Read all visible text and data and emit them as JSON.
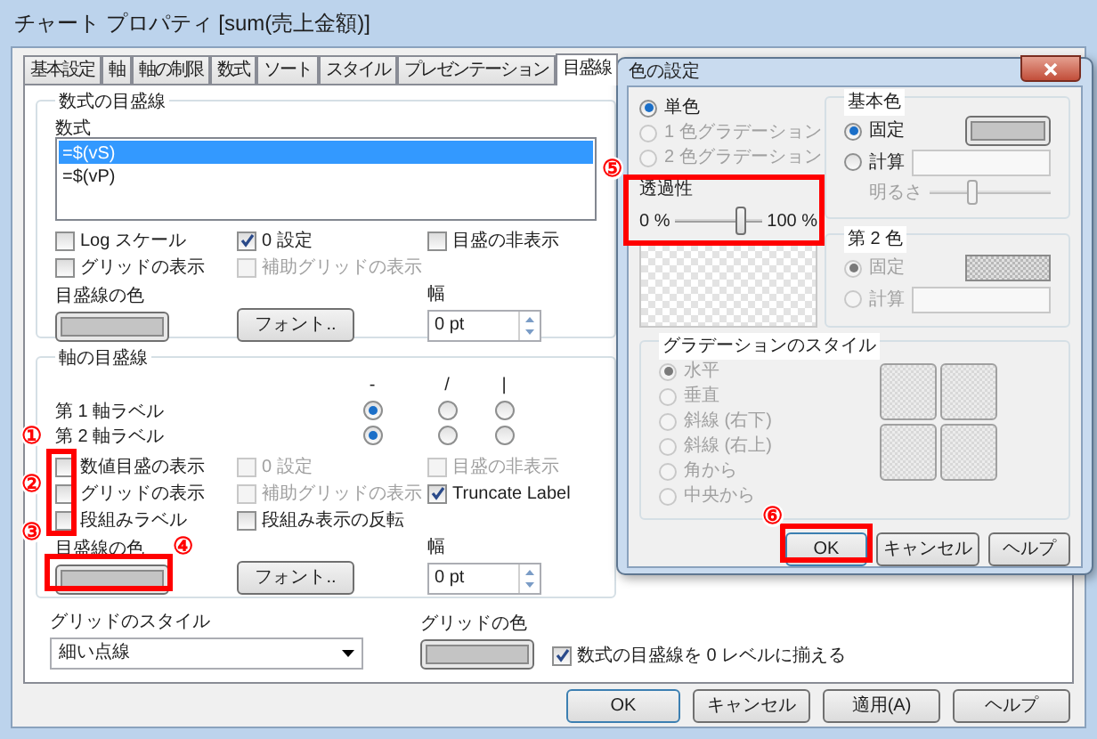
{
  "window": {
    "title": "チャート プロパティ [sum(売上金額)]"
  },
  "tabs": [
    {
      "label": "基本設定",
      "selected": false
    },
    {
      "label": "軸",
      "selected": false
    },
    {
      "label": "軸の制限",
      "selected": false
    },
    {
      "label": "数式",
      "selected": false
    },
    {
      "label": "ソート",
      "selected": false
    },
    {
      "label": "スタイル",
      "selected": false
    },
    {
      "label": "プレゼンテーション",
      "selected": false
    },
    {
      "label": "目盛線",
      "selected": true
    }
  ],
  "formula_gridlines": {
    "title": "数式の目盛線",
    "list_label": "数式",
    "items": [
      {
        "text": "=$(vS)",
        "selected": true
      },
      {
        "text": "=$(vP)",
        "selected": false
      }
    ],
    "checkboxes": [
      {
        "label": "Log スケール",
        "checked": false,
        "disabled": false
      },
      {
        "label": "0 設定",
        "checked": true,
        "disabled": false
      },
      {
        "label": "目盛の非表示",
        "checked": false,
        "disabled": false
      },
      {
        "label": "グリッドの表示",
        "checked": false,
        "disabled": false
      },
      {
        "label": "補助グリッドの表示",
        "checked": false,
        "disabled": true
      }
    ],
    "color_label": "目盛線の色",
    "font_button": "フォント..",
    "width_label": "幅",
    "width_value": "0 pt"
  },
  "axis_gridlines": {
    "title": "軸の目盛線",
    "columns": [
      "-",
      "/",
      "|"
    ],
    "rows": [
      {
        "label": "第 1 軸ラベル",
        "options": [
          {
            "selected": true
          },
          {
            "selected": false
          },
          {
            "selected": false
          }
        ]
      },
      {
        "label": "第 2 軸ラベル",
        "options": [
          {
            "selected": true
          },
          {
            "selected": false
          },
          {
            "selected": false
          }
        ]
      }
    ],
    "checkboxes": [
      {
        "label": "数値目盛の表示",
        "checked": false,
        "disabled": false
      },
      {
        "label": "0 設定",
        "checked": false,
        "disabled": true
      },
      {
        "label": "目盛の非表示",
        "checked": false,
        "disabled": true
      },
      {
        "label": "グリッドの表示",
        "checked": false,
        "disabled": false
      },
      {
        "label": "補助グリッドの表示",
        "checked": false,
        "disabled": true
      },
      {
        "label": "Truncate Label",
        "checked": true,
        "disabled": false
      },
      {
        "label": "段組みラベル",
        "checked": false,
        "disabled": false
      },
      {
        "label": "段組み表示の反転",
        "checked": false,
        "disabled": false
      }
    ],
    "color_label": "目盛線の色",
    "font_button": "フォント..",
    "width_label": "幅",
    "width_value": "0 pt"
  },
  "grid_style": {
    "label": "グリッドのスタイル",
    "value": "細い点線"
  },
  "grid_color": {
    "label": "グリッドの色"
  },
  "align_checkbox": {
    "label": "数式の目盛線を 0 レベルに揃える",
    "checked": true,
    "disabled": false
  },
  "buttons": [
    "OK",
    "キャンセル",
    "適用(A)",
    "ヘルプ"
  ],
  "color_dialog": {
    "title": "色の設定",
    "fill_modes": [
      {
        "label": "単色",
        "selected": true,
        "disabled": false
      },
      {
        "label": "1 色グラデーション",
        "selected": false,
        "disabled": true
      },
      {
        "label": "2 色グラデーション",
        "selected": false,
        "disabled": true
      }
    ],
    "transparency": {
      "label": "透過性",
      "min": "0 %",
      "max": "100 %",
      "level": 0.75
    },
    "base_color": {
      "title": "基本色",
      "options": [
        {
          "label": "固定",
          "selected": true,
          "disabled": false
        },
        {
          "label": "計算",
          "selected": false,
          "disabled": false
        }
      ],
      "brightness_label": "明るさ",
      "brightness": {
        "level": 0.35
      }
    },
    "second_color": {
      "title": "第 2 色",
      "options": [
        {
          "label": "固定",
          "selected": true,
          "disabled": true
        },
        {
          "label": "計算",
          "selected": false,
          "disabled": true
        }
      ]
    },
    "gradient_style": {
      "title": "グラデーションのスタイル",
      "options": [
        {
          "label": "水平",
          "selected": true,
          "disabled": true
        },
        {
          "label": "垂直",
          "selected": false,
          "disabled": true
        },
        {
          "label": "斜線 (右下)",
          "selected": false,
          "disabled": true
        },
        {
          "label": "斜線 (右上)",
          "selected": false,
          "disabled": true
        },
        {
          "label": "角から",
          "selected": false,
          "disabled": true
        },
        {
          "label": "中央から",
          "selected": false,
          "disabled": true
        }
      ]
    },
    "buttons": [
      "OK",
      "キャンセル",
      "ヘルプ"
    ]
  },
  "annotations": [
    {
      "text": "①"
    },
    {
      "text": "②"
    },
    {
      "text": "③"
    },
    {
      "text": "④"
    },
    {
      "text": "⑤"
    },
    {
      "text": "⑥"
    }
  ]
}
